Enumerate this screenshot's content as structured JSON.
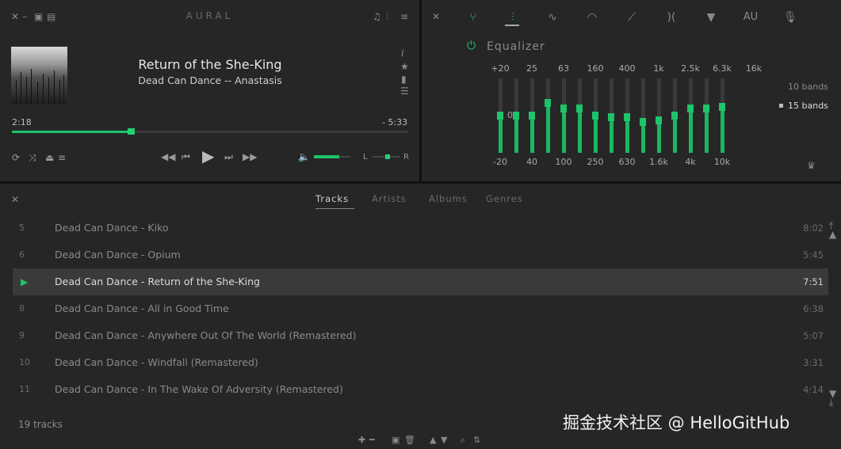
{
  "player": {
    "app_title": "AURAL",
    "track_title": "Return of the She-King",
    "track_artist": "Dead Can Dance -- Anastasis",
    "time_elapsed": "2:18",
    "time_remaining": "- 5:33",
    "progress": 0.3,
    "volume": 0.7,
    "balance_left": "L",
    "balance_right": "R",
    "balance": 0.55,
    "side_info_label": "i"
  },
  "equalizer": {
    "title": "Equalizer",
    "tabs": [
      "routing-icon",
      "equalizer-icon",
      "pulse-icon",
      "speedometer-icon",
      "reverb-icon",
      "stereo-icon",
      "filter-icon",
      "AU",
      "microphone-icon"
    ],
    "au_label": "AU",
    "top_labels": [
      "+20",
      "25",
      "63",
      "160",
      "400",
      "1k",
      "2.5k",
      "6.3k",
      "16k"
    ],
    "bottom_labels": [
      "-20",
      "40",
      "100",
      "250",
      "630",
      "1.6k",
      "4k",
      "10k"
    ],
    "zero_label": "0",
    "band_levels": [
      0.5,
      0.5,
      0.5,
      0.67,
      0.6,
      0.6,
      0.5,
      0.48,
      0.48,
      0.42,
      0.44,
      0.5,
      0.6,
      0.6,
      0.62
    ],
    "band_options": [
      "10 bands",
      "15 bands"
    ],
    "selected_band_option": "15 bands"
  },
  "playlist": {
    "tabs": [
      "Tracks",
      "Artists",
      "Albums",
      "Genres"
    ],
    "active_tab": "Tracks",
    "tracks": [
      {
        "num": "5",
        "name": "Dead Can Dance - Kiko",
        "dur": "8:02"
      },
      {
        "num": "6",
        "name": "Dead Can Dance - Opium",
        "dur": "5:45"
      },
      {
        "num": "",
        "name": "Dead Can Dance - Return of the She-King",
        "dur": "7:51",
        "active": true
      },
      {
        "num": "8",
        "name": "Dead Can Dance - All in Good Time",
        "dur": "6:38"
      },
      {
        "num": "9",
        "name": "Dead Can Dance - Anywhere Out Of The World (Remastered)",
        "dur": "5:07"
      },
      {
        "num": "10",
        "name": "Dead Can Dance - Windfall (Remastered)",
        "dur": "3:31"
      },
      {
        "num": "11",
        "name": "Dead Can Dance - In The Wake Of Adversity (Remastered)",
        "dur": "4:14"
      }
    ],
    "track_count": "19 tracks"
  },
  "watermark": "掘金技术社区 @ HelloGitHub",
  "colors": {
    "accent": "#1ec46a",
    "panel": "#262626",
    "background": "#111111"
  }
}
